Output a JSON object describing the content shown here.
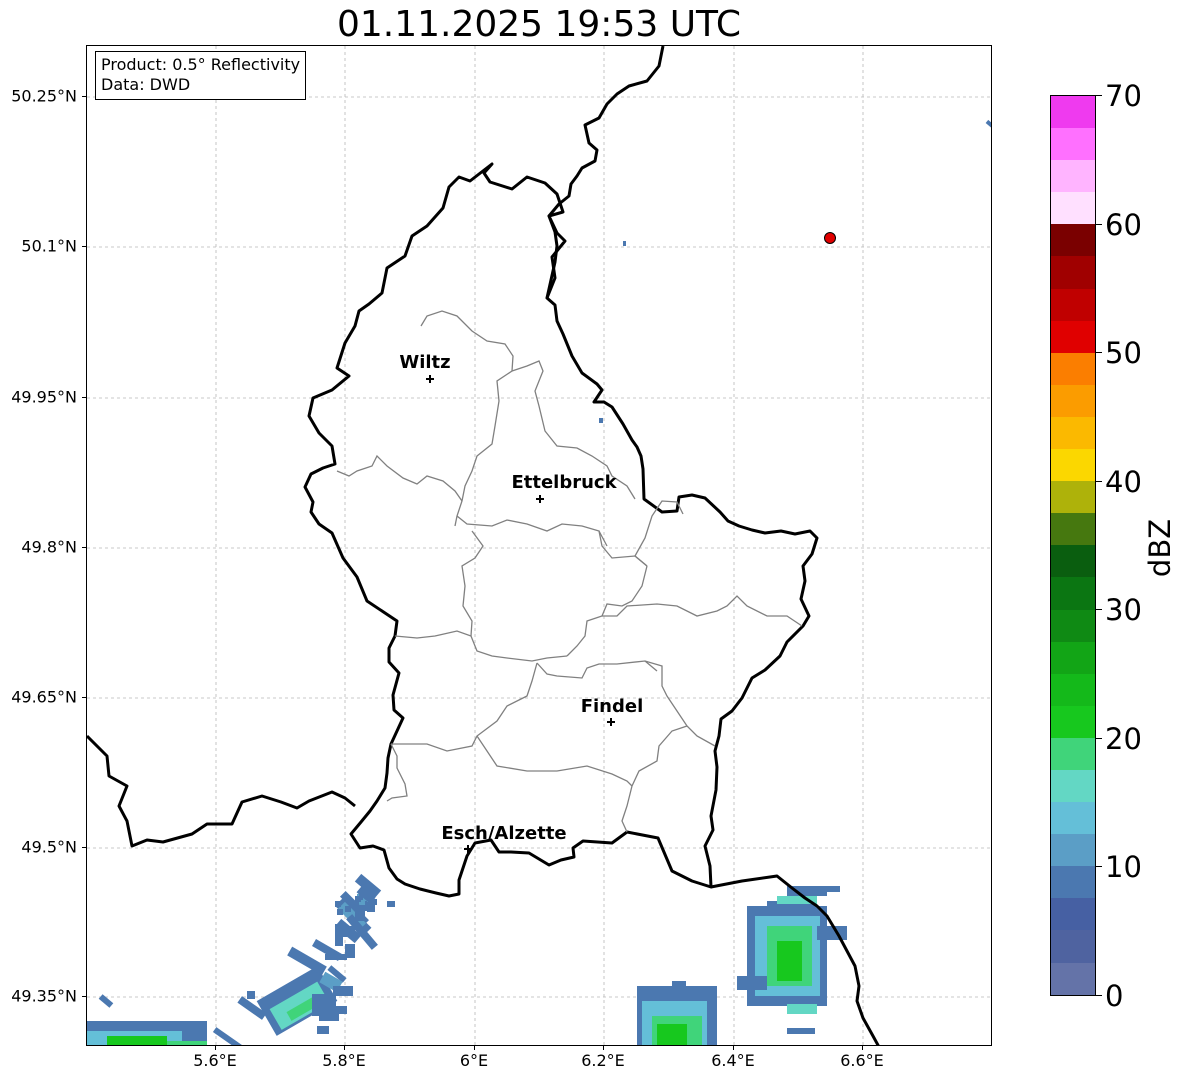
{
  "title": "01.11.2025 19:53 UTC",
  "info": {
    "product": "Product: 0.5° Reflectivity",
    "source": "Data: DWD"
  },
  "axes": {
    "lat_labels": [
      "50.25°N",
      "50.1°N",
      "49.95°N",
      "49.8°N",
      "49.65°N",
      "49.5°N",
      "49.35°N"
    ],
    "lon_labels": [
      "5.6°E",
      "5.8°E",
      "6°E",
      "6.2°E",
      "6.4°E",
      "6.6°E"
    ]
  },
  "cities": [
    {
      "name": "Wiltz",
      "lat": 49.966,
      "lon": 5.932
    },
    {
      "name": "Ettelbruck",
      "lat": 49.847,
      "lon": 6.104
    },
    {
      "name": "Findel",
      "lat": 49.627,
      "lon": 6.211
    },
    {
      "name": "Esch/Alzette",
      "lat": 49.5,
      "lon": 5.986
    }
  ],
  "radar_site": {
    "lat": 50.11,
    "lon": 6.548,
    "color": "#e00000"
  },
  "colorbar": {
    "unit": "dBZ",
    "min": 0,
    "max": 70,
    "ticks": [
      "0",
      "10",
      "20",
      "30",
      "40",
      "50",
      "60",
      "70"
    ],
    "colors": [
      "#6473a8",
      "#4f63a0",
      "#4660a3",
      "#4b78b0",
      "#5b9ec6",
      "#64bfd8",
      "#63d7c4",
      "#40d47a",
      "#17c81e",
      "#14b91a",
      "#12a516",
      "#0f8a14",
      "#0b7612",
      "#0a5e0f",
      "#46780f",
      "#aeb20a",
      "#fbd700",
      "#fbb900",
      "#fb9c00",
      "#fb7e00",
      "#e00000",
      "#c00000",
      "#a00000",
      "#7a0000",
      "#ffe0ff",
      "#ffb4ff",
      "#ff70ff",
      "#ef3aef"
    ]
  }
}
